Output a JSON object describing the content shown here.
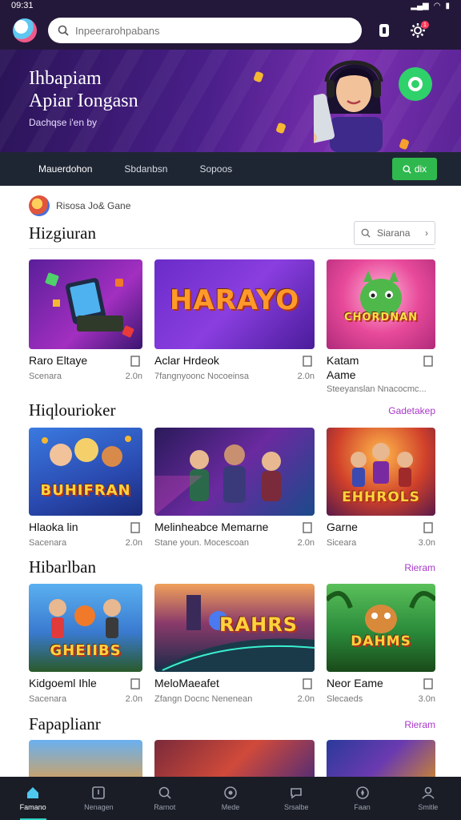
{
  "status": {
    "time": "09:31"
  },
  "search": {
    "placeholder": "Inpeerarohpabans"
  },
  "header": {
    "notif_count": "1"
  },
  "hero": {
    "title_line1": "Ihbapiam",
    "title_line2": "Apiar Iongasn",
    "subtitle": "Dachqse i'en by"
  },
  "tabs": {
    "items": [
      "Mauerdohon",
      "Sbdanbsn",
      "Sopoos"
    ],
    "cta": "dix"
  },
  "provider": {
    "label": "Risosa Jo& Gane"
  },
  "sections": [
    {
      "title": "Hizgiuran",
      "sort_label": "Siarana",
      "cards": [
        {
          "name": "Raro Eltaye",
          "meta": "Scenara",
          "size": "2.0n",
          "art": "phone"
        },
        {
          "name": "Aclar Hrdeok",
          "meta": "7fangnyoonc Nocoeinsa",
          "size": "2.0n",
          "art_title": "HARAYO",
          "art": "letters"
        },
        {
          "name": "Katam",
          "name2": "Aame",
          "meta": "Steeyanslan Nnacocmc...",
          "size": "",
          "art_title": "CHORDNAN",
          "art": "creature"
        }
      ]
    },
    {
      "title": "Hiqlourioker",
      "see_all": "Gadetakep",
      "cards": [
        {
          "name": "Hlaoka lin",
          "meta": "Sacenara",
          "size": "2.0n",
          "art_title": "BUHIFRAN",
          "art": "heroes"
        },
        {
          "name": "Melinheabce Memarne",
          "meta": "Stane youn. Mocescoan",
          "size": "2.0n",
          "art": "squad"
        },
        {
          "name": "Garne",
          "meta": "Siceara",
          "size": "3.0n",
          "art_title": "EHHROLS",
          "art": "warriors"
        }
      ]
    },
    {
      "title": "Hibarlban",
      "see_all": "Rieram",
      "cards": [
        {
          "name": "Kidgoeml Ihle",
          "meta": "Sacenara",
          "size": "2.0n",
          "art_title": "GHEIIBS",
          "art": "kids"
        },
        {
          "name": "MeloMaeafet",
          "meta": "Zfangn Docnc Nenenean",
          "size": "2.0n",
          "art_title": "RAHRS",
          "art": "race"
        },
        {
          "name": "Neor Eame",
          "meta": "Slecaeds",
          "size": "3.0n",
          "art_title": "DAHMS",
          "art": "jungle"
        }
      ]
    },
    {
      "title": "Fapaplianr",
      "see_all": "Rieram",
      "cards": [
        {
          "art": "peek1"
        },
        {
          "art": "peek2"
        },
        {
          "art": "peek3"
        }
      ]
    }
  ],
  "nav": {
    "items": [
      "Famano",
      "Nenagen",
      "Rarnot",
      "Mede",
      "Srsalbe",
      "Faan",
      "Smitle"
    ]
  },
  "colors": {
    "accent": "#a838c8",
    "brand_dark": "#24183a",
    "cta_green": "#2fb84e"
  }
}
